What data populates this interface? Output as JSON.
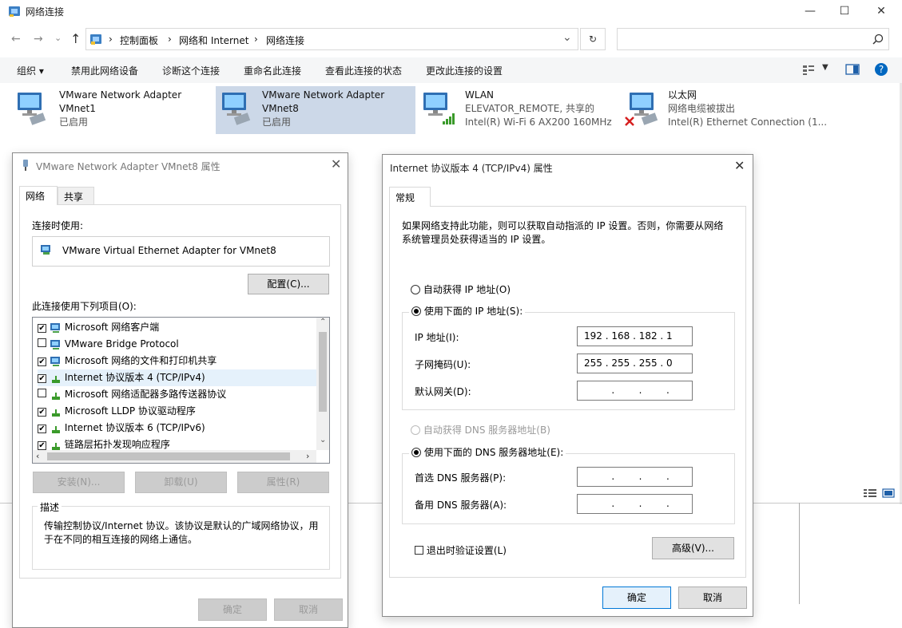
{
  "window": {
    "title": "网络连接",
    "minimize": "—",
    "maximize": "☐",
    "close": "✕"
  },
  "address": {
    "crumbs": [
      "控制面板",
      "网络和 Internet",
      "网络连接"
    ],
    "separator": "›",
    "dropdown": "⌄",
    "refresh": "↻",
    "search_placeholder": ""
  },
  "toolbar": {
    "items": [
      "组织 ▾",
      "禁用此网络设备",
      "诊断这个连接",
      "重命名此连接",
      "查看此连接的状态",
      "更改此连接的设置"
    ]
  },
  "adapters": [
    {
      "name": "VMware Network Adapter",
      "line2": "VMnet1",
      "line3": "已启用"
    },
    {
      "name": "VMware Network Adapter",
      "line2": "VMnet8",
      "line3": "已启用"
    },
    {
      "name": "WLAN",
      "line2": "ELEVATOR_REMOTE, 共享的",
      "line3": "Intel(R) Wi-Fi 6 AX200 160MHz"
    },
    {
      "name": "以太网",
      "line2": "网络电缆被拔出",
      "line3": "Intel(R) Ethernet Connection (1..."
    }
  ],
  "props_dialog": {
    "title": "VMware Network Adapter VMnet8 属性",
    "tabs": [
      "网络",
      "共享"
    ],
    "connect_using_label": "连接时使用:",
    "adapter_name": "VMware Virtual Ethernet Adapter for VMnet8",
    "configure": "配置(C)...",
    "items_label": "此连接使用下列项目(O):",
    "items": [
      {
        "label": "Microsoft 网络客户端",
        "checked": "✔"
      },
      {
        "label": "VMware Bridge Protocol",
        "checked": ""
      },
      {
        "label": "Microsoft 网络的文件和打印机共享",
        "checked": "✔"
      },
      {
        "label": "Internet 协议版本 4 (TCP/IPv4)",
        "checked": "✔"
      },
      {
        "label": "Microsoft 网络适配器多路传送器协议",
        "checked": ""
      },
      {
        "label": "Microsoft LLDP 协议驱动程序",
        "checked": "✔"
      },
      {
        "label": "Internet 协议版本 6 (TCP/IPv6)",
        "checked": "✔"
      },
      {
        "label": "链路层拓扑发现响应程序",
        "checked": "✔"
      }
    ],
    "install": "安装(N)...",
    "uninstall": "卸载(U)",
    "properties": "属性(R)",
    "desc_label": "描述",
    "description": "传输控制协议/Internet 协议。该协议是默认的广域网络协议，用于在不同的相互连接的网络上通信。",
    "ok": "确定",
    "cancel": "取消"
  },
  "ipv4_dialog": {
    "title": "Internet 协议版本 4 (TCP/IPv4) 属性",
    "tab": "常规",
    "intro": "如果网络支持此功能，则可以获取自动指派的 IP 设置。否则，你需要从网络系统管理员处获得适当的 IP 设置。",
    "auto_ip": "自动获得 IP 地址(O)",
    "manual_ip": "使用下面的 IP 地址(S):",
    "ip_label": "IP 地址(I):",
    "ip_value": "192 . 168 . 182 .   1",
    "mask_label": "子网掩码(U):",
    "mask_value": "255 . 255 . 255 .   0",
    "gateway_label": "默认网关(D):",
    "gateway_value": "         .        .        .",
    "auto_dns": "自动获得 DNS 服务器地址(B)",
    "manual_dns": "使用下面的 DNS 服务器地址(E):",
    "pref_dns_label": "首选 DNS 服务器(P):",
    "pref_dns_value": "         .        .        .",
    "alt_dns_label": "备用 DNS 服务器(A):",
    "alt_dns_value": "         .        .        .",
    "validate": "退出时验证设置(L)",
    "advanced": "高级(V)...",
    "ok": "确定",
    "cancel": "取消"
  },
  "colors": {
    "selected_tile": "#ccd8e8",
    "accent": "#0078d7",
    "help": "#0067c0"
  }
}
